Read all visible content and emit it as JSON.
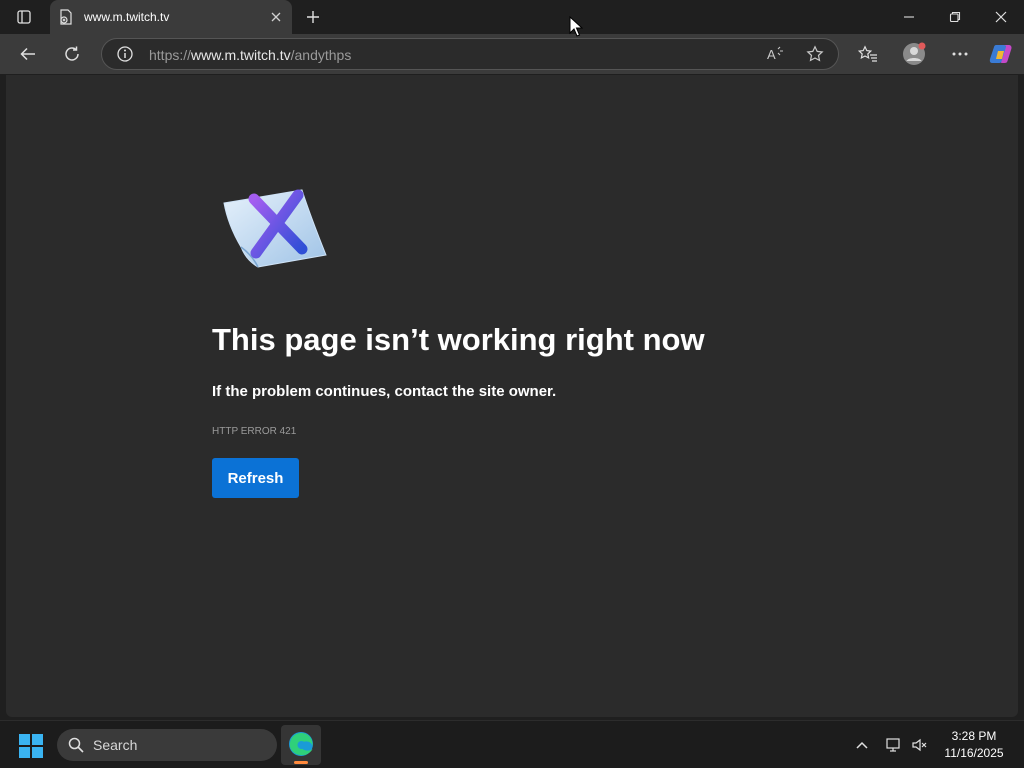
{
  "browser": {
    "tab": {
      "title": "www.m.twitch.tv"
    },
    "address": {
      "scheme": "https://",
      "host": "www.m.twitch.tv",
      "path": "/andythps"
    }
  },
  "error_page": {
    "headline": "This page isn’t working right now",
    "subtext": "If the problem continues, contact the site owner.",
    "error_code": "HTTP ERROR 421",
    "refresh_label": "Refresh"
  },
  "taskbar": {
    "search_label": "Search",
    "time": "3:28 PM",
    "date": "11/16/2025"
  },
  "colors": {
    "accent": "#0b72d6",
    "page_bg": "#2b2b2b",
    "chrome_bg": "#1f1f1f"
  }
}
